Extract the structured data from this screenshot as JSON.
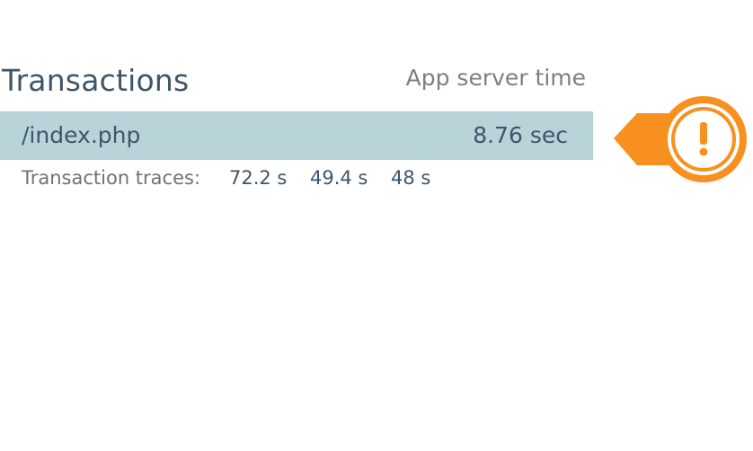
{
  "panel": {
    "title": "Transactions",
    "column_label": "App server time"
  },
  "rows": [
    {
      "name": "/index.php",
      "time": "8.76 sec"
    }
  ],
  "traces": {
    "label": "Transaction traces:",
    "values": [
      "72.2 s",
      "49.4 s",
      "48 s"
    ]
  },
  "alert": {
    "icon": "exclamation-alert-icon",
    "color": "#f7901e"
  },
  "colors": {
    "row_highlight": "#b9d4d8",
    "text_primary": "#3f556b",
    "text_secondary": "#7b7f83"
  }
}
